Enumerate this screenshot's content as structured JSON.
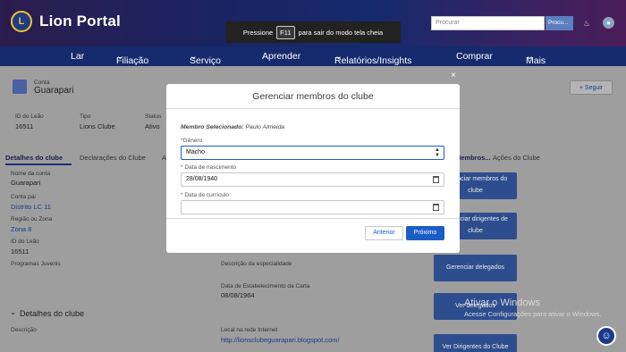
{
  "header": {
    "brand": "Lion Portal",
    "logo_letter": "L",
    "search_placeholder": "Procurar",
    "search_button": "Procu..."
  },
  "fullscreen_notice": {
    "before": "Pressione",
    "key": "F11",
    "after": "para sair do modo tela cheia"
  },
  "nav": {
    "items": [
      "Lar",
      "Filiação",
      "Serviço",
      "Aprender",
      "Relatórios/Insights",
      "Comprar",
      "Mais"
    ]
  },
  "account": {
    "type_label": "Conta",
    "name": "Guarapari",
    "follow": "Seguir"
  },
  "summary": {
    "id_label": "ID do Leão",
    "id_value": "16511",
    "type_label": "Tipo",
    "type_value": "Lions Clube",
    "status_label": "Status",
    "status_value": "Ativo"
  },
  "tabs": {
    "details": "Detalhes do clube",
    "declarations": "Declarações do Clube",
    "third": "A",
    "members": "Membros...",
    "actions": "Ações do Clube"
  },
  "details": {
    "account_name_label": "Nome da conta",
    "account_name": "Guarapari",
    "parent_label": "Conta pai",
    "parent": "Distrito LC 11",
    "region_label": "Região ou Zona",
    "region": "Zona  8",
    "lion_id_label": "ID do Leão",
    "lion_id": "16511",
    "youth_label": "Programas Juvenis",
    "specialty_label": "Descrição da especialidade",
    "established_label": "Data de Estabelecimento da Carta",
    "established": "08/08/1964",
    "section_title": "Detalhes do clube",
    "description_label": "Descrição",
    "website_label": "Local na rede Internet",
    "website": "http://lionsclubeguarapari.blogspot.com/"
  },
  "right_buttons": [
    "Gerenciar membros do clube",
    "Gerenciar dirigentes de clube",
    "Gerenciar delegados",
    "Ver delegados",
    "Ver Dirigentes do Clube"
  ],
  "watermark": {
    "title": "Ativar o Windows",
    "subtitle": "Acesse Configurações para ativar o Windows."
  },
  "modal": {
    "title": "Gerenciar membros do clube",
    "close": "×",
    "selected_label": "Membro Selecionado:",
    "selected_value": "Paulo Almeida",
    "gender_label": "Gênero",
    "gender_value": "Macho",
    "birth_label": "Data de nascimento",
    "birth_value": "28/08/1940",
    "resume_label": "Data de currículo",
    "resume_value": "",
    "prev": "Anterior",
    "next": "Próximo"
  },
  "colors": {
    "nav": "#162a6e",
    "primary": "#1b5cc8",
    "overlay_button": "#2d4d8f"
  }
}
